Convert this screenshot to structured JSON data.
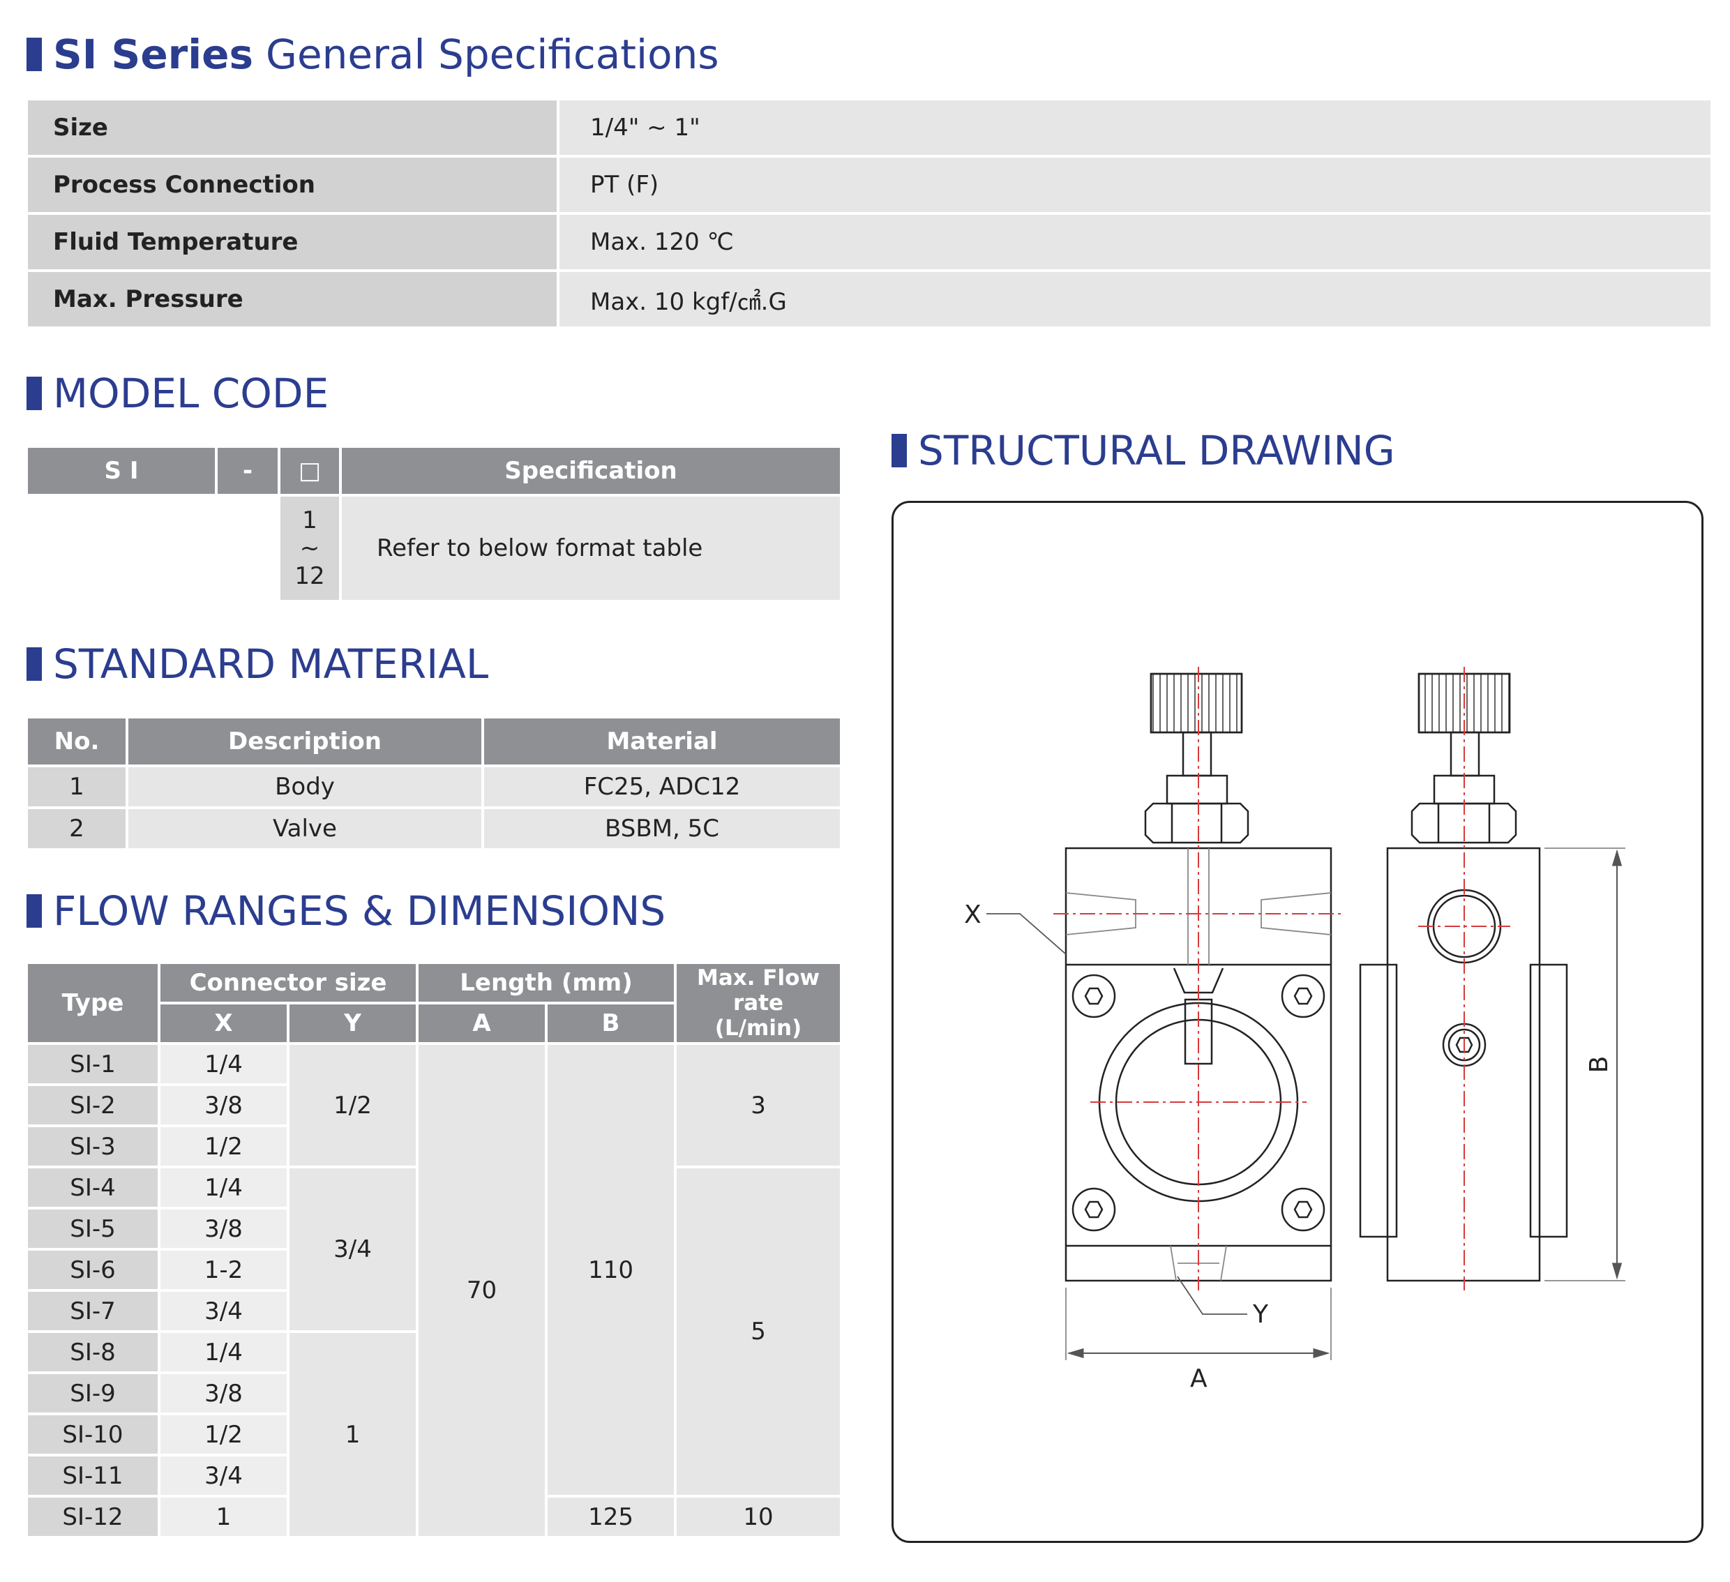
{
  "general": {
    "title_bold": "SI Series",
    "title_rest": "General Specifications",
    "rows": [
      {
        "label": "Size",
        "value": "1/4\" ~ 1\""
      },
      {
        "label": "Process Connection",
        "value": "PT (F)"
      },
      {
        "label": "Fluid Temperature",
        "value": "Max. 120 ℃"
      },
      {
        "label": "Max. Pressure",
        "value": "Max. 10 kgf/㎠.G"
      }
    ]
  },
  "model_code": {
    "title": "MODEL CODE",
    "headers": [
      "S I",
      "-",
      "□",
      "Specification"
    ],
    "range_top": "1",
    "range_mid": "~",
    "range_bottom": "12",
    "description": "Refer to below format table"
  },
  "material": {
    "title": "STANDARD MATERIAL",
    "headers": [
      "No.",
      "Description",
      "Material"
    ],
    "rows": [
      {
        "no": "1",
        "desc": "Body",
        "material": "FC25, ADC12"
      },
      {
        "no": "2",
        "desc": "Valve",
        "material": "BSBM, 5C"
      }
    ]
  },
  "flow": {
    "title": "FLOW RANGES & DIMENSIONS",
    "headers": {
      "type": "Type",
      "connector": "Connector size",
      "length": "Length (mm)",
      "flow_line1": "Max. Flow rate",
      "flow_line2": "(L/min)",
      "x": "X",
      "y": "Y",
      "a": "A",
      "b": "B"
    },
    "types": [
      "SI-1",
      "SI-2",
      "SI-3",
      "SI-4",
      "SI-5",
      "SI-6",
      "SI-7",
      "SI-8",
      "SI-9",
      "SI-10",
      "SI-11",
      "SI-12"
    ],
    "x": [
      "1/4",
      "3/8",
      "1/2",
      "1/4",
      "3/8",
      "1-2",
      "3/4",
      "1/4",
      "3/8",
      "1/2",
      "3/4",
      "1"
    ],
    "y_groups": [
      "1/2",
      "3/4",
      "1"
    ],
    "a_value": "70",
    "b_groups": [
      "110",
      "125"
    ],
    "flow_groups": [
      "3",
      "5",
      "10"
    ]
  },
  "drawing": {
    "title": "STRUCTURAL DRAWING",
    "labels": {
      "x": "X",
      "y": "Y",
      "a": "A",
      "b": "B"
    }
  }
}
